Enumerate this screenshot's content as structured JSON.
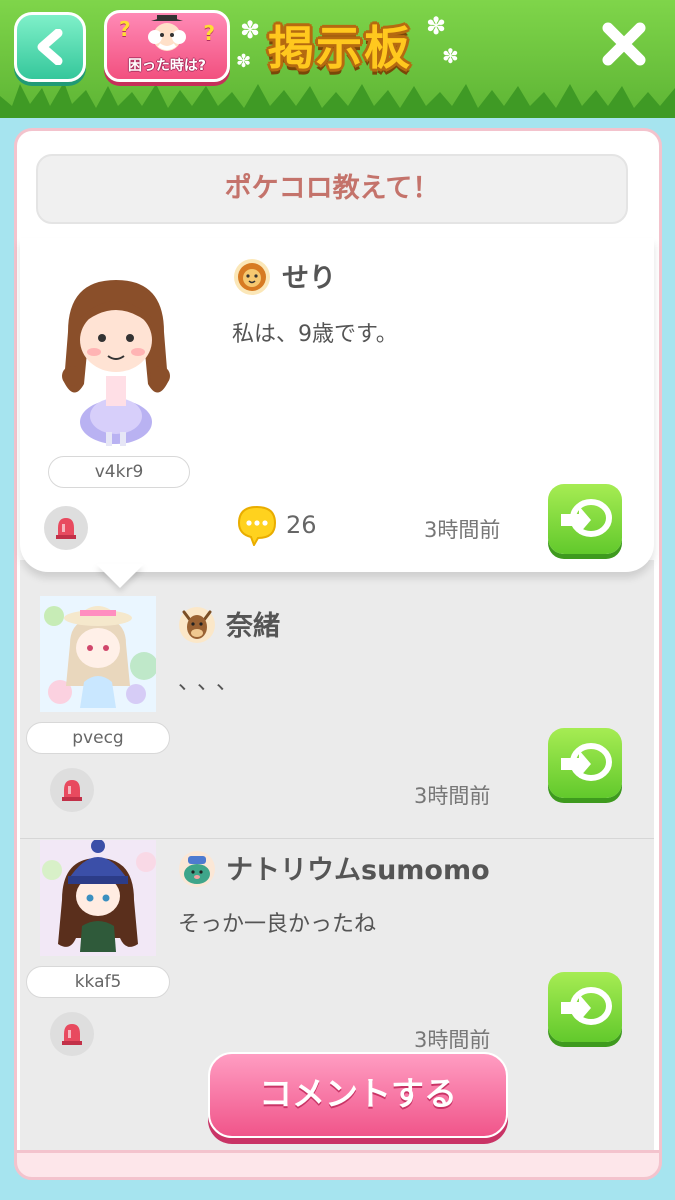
{
  "header": {
    "help_label": "困った時は?",
    "help_mark": "?",
    "title": "掲示板"
  },
  "topic": {
    "title": "ポケコロ教えて！"
  },
  "posts": [
    {
      "user_id": "v4kr9",
      "name": "せり",
      "message": "私は、9歳です。",
      "reply_count": "26",
      "time": "3時間前"
    },
    {
      "user_id": "pvecg",
      "name": "奈緒",
      "message": "、、、",
      "time": "3時間前"
    },
    {
      "user_id": "kkaf5",
      "name": "ナトリウムsumomo",
      "message": "そっか一良かったね",
      "time": "3時間前"
    }
  ],
  "comment_button": "コメントする",
  "icons": {
    "back": "chevron-left-icon",
    "close": "close-icon",
    "report": "alarm-icon",
    "reply": "arrow-balloon-icon",
    "comment": "speech-bubble-icon"
  },
  "colors": {
    "accent_green": "#62c92c",
    "accent_pink": "#f0558a",
    "topic_text": "#c4736b"
  }
}
